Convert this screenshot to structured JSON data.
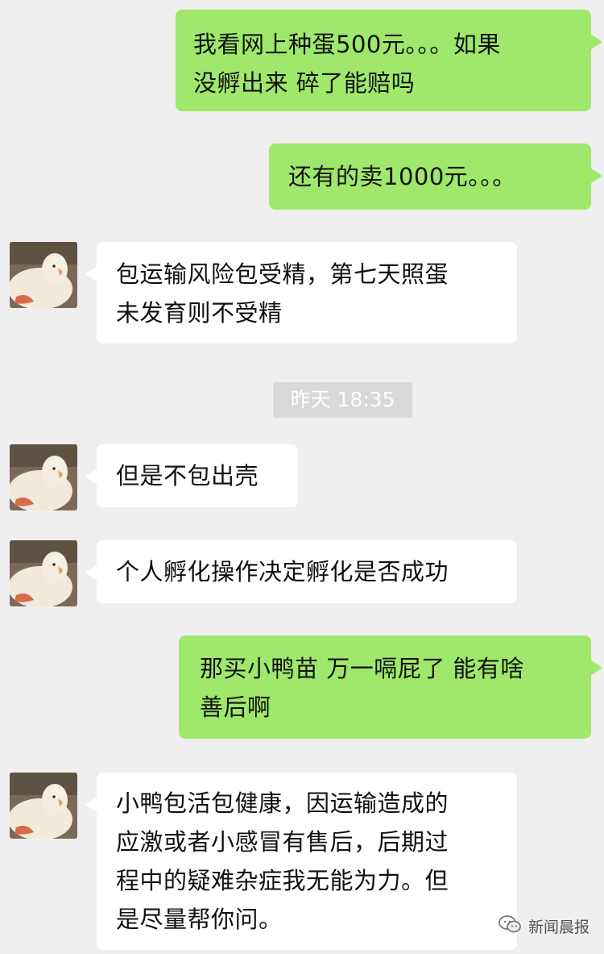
{
  "messages": [
    {
      "sender": "me",
      "text": "我看网上种蛋500元。。。如果\n没孵出来 碎了能赔吗"
    },
    {
      "sender": "me",
      "text": "还有的卖1000元。。。"
    },
    {
      "sender": "them",
      "text": "包运输风险包受精，第七天照蛋\n未发育则不受精"
    },
    {
      "sender": "them",
      "text": "但是不包出壳"
    },
    {
      "sender": "them",
      "text": "个人孵化操作决定孵化是否成功"
    },
    {
      "sender": "me",
      "text": "那买小鸭苗 万一嗝屁了 能有啥\n善后啊"
    },
    {
      "sender": "them",
      "text": "小鸭包活包健康，因运输造成的\n应激或者小感冒有售后，后期过\n程中的疑难杂症我无能为力。但\n是尽量帮你问。"
    }
  ],
  "timestamp": "昨天 18:35",
  "watermark": {
    "label": "新闻晨报",
    "icon": "wechat-icon"
  },
  "avatar_icon": "duck-avatar",
  "colors": {
    "background": "#efefef",
    "my_bubble": "#9fe86b",
    "their_bubble": "#ffffff",
    "timestamp_bg": "#d9d9d9"
  }
}
